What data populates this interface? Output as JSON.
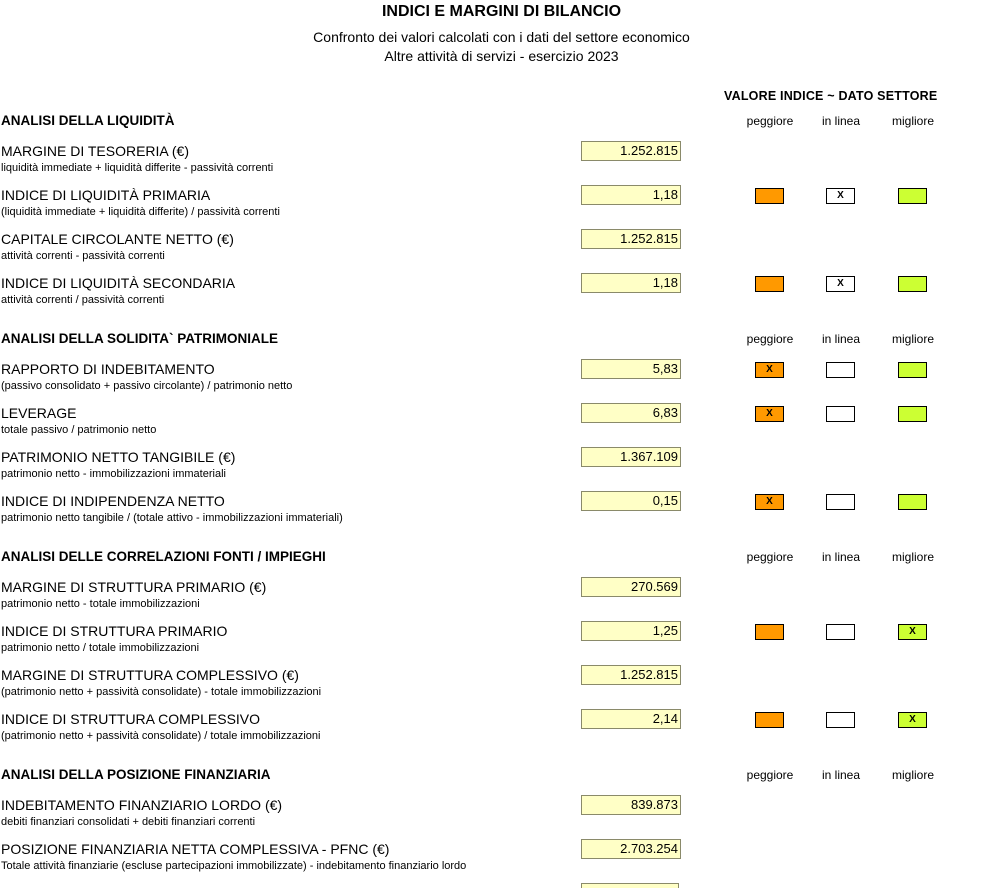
{
  "header": {
    "title": "INDICI E MARGINI DI BILANCIO",
    "subtitle1": "Confronto dei valori calcolati con i dati del settore economico",
    "subtitle2": "Altre attività di servizi - esercizio 2023",
    "legend": "VALORE INDICE ~ DATO SETTORE"
  },
  "columns": {
    "worse": "peggiore",
    "inline": "in linea",
    "better": "migliore"
  },
  "mark": "X",
  "colors": {
    "worse": "#ff9900",
    "inline": "#ffffff",
    "better": "#ccff33",
    "value_bg": "#ffffc6"
  },
  "sections": [
    {
      "title": "ANALISI DELLA LIQUIDITÀ",
      "items": [
        {
          "name": "MARGINE DI TESORERIA (€)",
          "desc": "liquidità immediate + liquidità differite - passività correnti",
          "value": "1.252.815"
        },
        {
          "name": "INDICE DI LIQUIDITÀ PRIMARIA",
          "desc": "(liquidità immediate + liquidità differite) / passività correnti",
          "value": "1,18",
          "rating": "inline"
        },
        {
          "name": "CAPITALE CIRCOLANTE NETTO (€)",
          "desc": "attività correnti - passività correnti",
          "value": "1.252.815"
        },
        {
          "name": "INDICE DI LIQUIDITÀ SECONDARIA",
          "desc": "attività correnti / passività correnti",
          "value": "1,18",
          "rating": "inline"
        }
      ]
    },
    {
      "title": "ANALISI DELLA SOLIDITA` PATRIMONIALE",
      "items": [
        {
          "name": "RAPPORTO DI INDEBITAMENTO",
          "desc": "(passivo consolidato + passivo circolante) / patrimonio netto",
          "value": "5,83",
          "rating": "worse"
        },
        {
          "name": "LEVERAGE",
          "desc": "totale passivo / patrimonio netto",
          "value": "6,83",
          "rating": "worse"
        },
        {
          "name": "PATRIMONIO NETTO TANGIBILE (€)",
          "desc": "patrimonio netto - immobilizzazioni immateriali",
          "value": "1.367.109"
        },
        {
          "name": "INDICE DI INDIPENDENZA NETTO",
          "desc": "patrimonio netto tangibile / (totale attivo - immobilizzazioni immateriali)",
          "value": "0,15",
          "rating": "worse"
        }
      ]
    },
    {
      "title": "ANALISI DELLE CORRELAZIONI FONTI / IMPIEGHI",
      "items": [
        {
          "name": "MARGINE DI STRUTTURA PRIMARIO (€)",
          "desc": "patrimonio netto - totale immobilizzazioni",
          "value": "270.569"
        },
        {
          "name": "INDICE DI STRUTTURA PRIMARIO",
          "desc": "patrimonio netto / totale immobilizzazioni",
          "value": "1,25",
          "rating": "better"
        },
        {
          "name": "MARGINE DI STRUTTURA COMPLESSIVO (€)",
          "desc": "(patrimonio netto + passività consolidate) - totale immobilizzazioni",
          "value": "1.252.815"
        },
        {
          "name": "INDICE DI STRUTTURA COMPLESSIVO",
          "desc": "(patrimonio netto + passività consolidate) / totale immobilizzazioni",
          "value": "2,14",
          "rating": "better"
        }
      ]
    },
    {
      "title": "ANALISI DELLA POSIZIONE FINANZIARIA",
      "items": [
        {
          "name": "INDEBITAMENTO FINANZIARIO LORDO (€)",
          "desc": "debiti finanziari consolidati + debiti finanziari correnti",
          "value": "839.873"
        },
        {
          "name": "POSIZIONE FINANZIARIA NETTA COMPLESSIVA - PFNC (€)",
          "desc": "Totale attività finanziarie (escluse partecipazioni immobilizzate) - indebitamento finanziario lordo",
          "value": "2.703.254"
        }
      ]
    }
  ]
}
